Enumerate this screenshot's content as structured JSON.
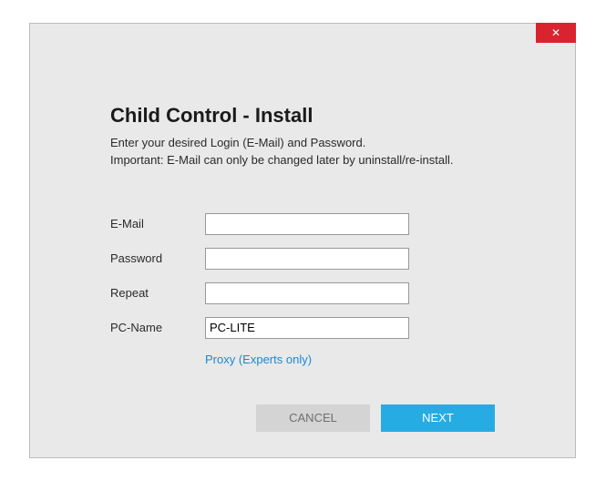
{
  "header": {
    "title": "Child Control - Install",
    "subtitle_line1": "Enter your desired Login (E-Mail) and Password.",
    "subtitle_line2": "Important: E-Mail can only be changed later by uninstall/re-install."
  },
  "form": {
    "email_label": "E-Mail",
    "email_value": "",
    "password_label": "Password",
    "password_value": "",
    "repeat_label": "Repeat",
    "repeat_value": "",
    "pcname_label": "PC-Name",
    "pcname_value": "PC-LITE",
    "proxy_link": "Proxy (Experts only)"
  },
  "buttons": {
    "cancel": "CANCEL",
    "next": "NEXT"
  },
  "close_icon": "✕"
}
